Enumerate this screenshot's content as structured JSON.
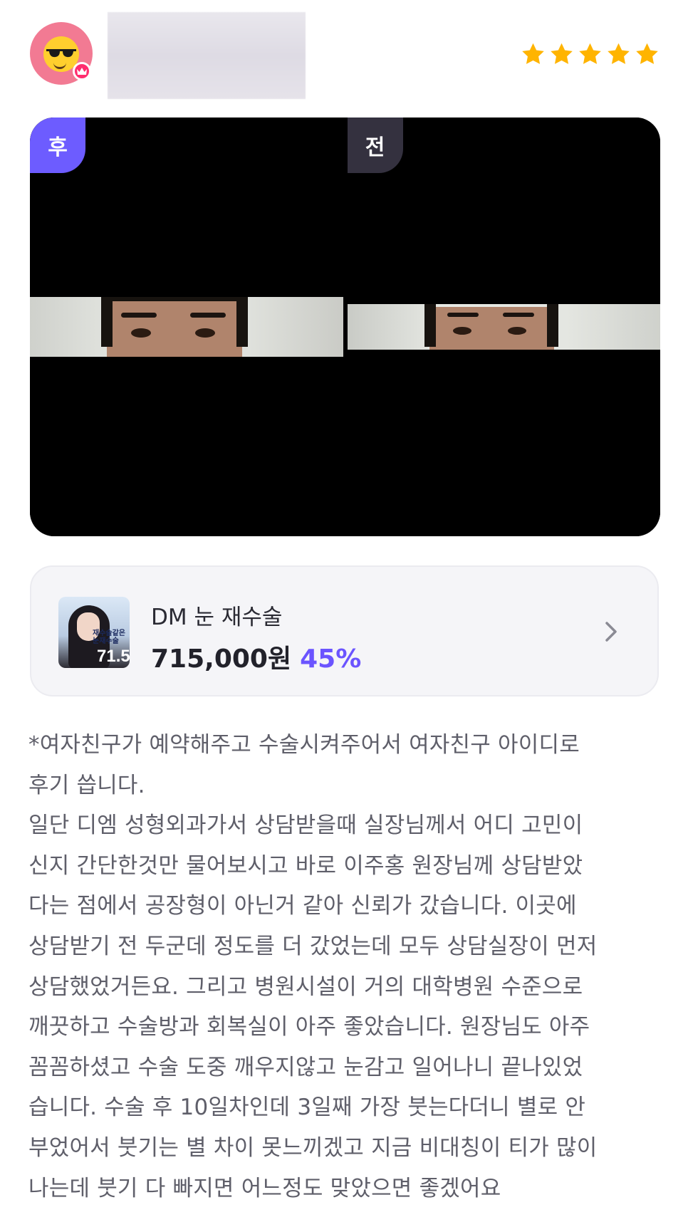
{
  "header": {
    "avatar_icon": "cool-face-sunglasses-icon",
    "crown_icon": "crown-badge-icon",
    "username": "",
    "rating": 5,
    "rating_max": 5,
    "star_color": "#ffb400"
  },
  "photos": {
    "after_label": "후",
    "before_label": "전",
    "after_color": "#6d5cff",
    "before_color": "#34313f"
  },
  "product": {
    "name": "DM 눈 재수술",
    "price": "715,000원",
    "discount": "45%",
    "thumbnail_text_small": "재수술같은 눈재수술",
    "thumbnail_text_big": "71.5",
    "accent_color": "#6b54ff",
    "chevron_icon": "chevron-right-icon"
  },
  "review": {
    "text": "*여자친구가 예약해주고 수술시켜주어서 여자친구 아이디로\n후기 씁니다.\n일단 디엠 성형외과가서 상담받을때 실장님께서 어디 고민이\n신지 간단한것만 물어보시고 바로 이주홍 원장님께 상담받았\n다는 점에서 공장형이 아닌거 같아 신뢰가 갔습니다. 이곳에\n상담받기 전 두군데 정도를 더 갔었는데 모두 상담실장이 먼저\n상담했었거든요. 그리고 병원시설이 거의 대학병원 수준으로\n깨끗하고 수술방과 회복실이 아주 좋았습니다. 원장님도 아주\n꼼꼼하셨고 수술 도중 깨우지않고 눈감고 일어나니 끝나있었\n습니다. 수술 후 10일차인데 3일째 가장 붓는다더니 별로 안\n부었어서 붓기는 별 차이 못느끼겠고 지금 비대칭이 티가 많이\n나는데 붓기 다 빠지면 어느정도 맞았으면 좋겠어요"
  }
}
